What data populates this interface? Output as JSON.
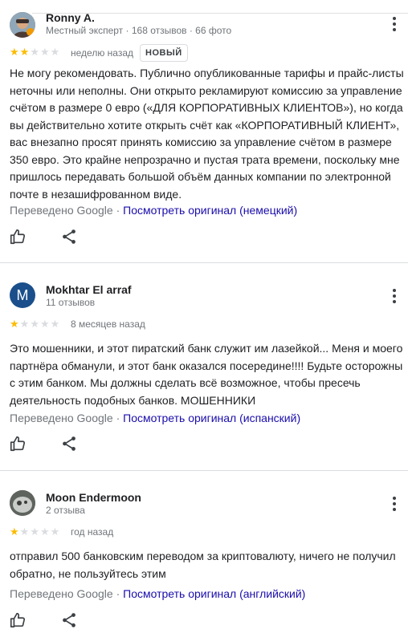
{
  "reviews": [
    {
      "name": "Ronny A.",
      "meta": "Местный эксперт · 168 отзывов · 66 фото",
      "rating": 2,
      "date": "неделю назад",
      "badge": "НОВЫЙ",
      "text": "Не могу рекомендовать. Публично опубликованные тарифы и прайс-листы неточны или неполны. Они открыто рекламируют комиссию за управление счётом в размере 0 евро («ДЛЯ КОРПОРАТИВНЫХ КЛИЕНТОВ»), но когда вы действительно хотите открыть счёт как «КОРПОРАТИВНЫЙ КЛИЕНТ», вас внезапно просят принять комиссию за управление счётом в размере 350 евро. Это крайне непрозрачно и пустая трата времени, поскольку мне пришлось передавать большой объём данных компании по электронной почте в незашифрованном виде.",
      "translated": "Переведено Google · ",
      "original_link": "Посмотреть оригинал (немецкий)",
      "avatar_color": "#b9825a"
    },
    {
      "name": "Mokhtar El arraf",
      "meta": "11 отзывов",
      "rating": 1,
      "date": "8 месяцев назад",
      "avatar_letter": "M",
      "text": "Это мошенники, и этот пиратский банк служит им лазейкой... Меня и моего партнёра обманули, и этот банк оказался посередине!!!! Будьте осторожны с этим банком. Мы должны сделать всё возможное, чтобы пресечь деятельность подобных банков. МОШЕННИКИ",
      "translated": "Переведено Google · ",
      "original_link": "Посмотреть оригинал (испанский)",
      "avatar_color": "#1a4f8b"
    },
    {
      "name": "Moon Endermoon",
      "meta": "2 отзыва",
      "rating": 1,
      "date": "год назад",
      "text": "отправил 500 банковским переводом за криптовалюту, ничего не получил обратно, не пользуйтесь этим",
      "translated": "Переведено Google · ",
      "original_link": "Посмотреть оригинал (английский)",
      "avatar_color": "#7a7f7a"
    }
  ],
  "colors": {
    "star_filled": "#fbbc04",
    "star_empty": "#dadce0",
    "link": "#1a0dab",
    "secondary_text": "#70757a"
  },
  "icons": [
    "menu-dots-icon",
    "thumbs-up-icon",
    "share-icon"
  ]
}
